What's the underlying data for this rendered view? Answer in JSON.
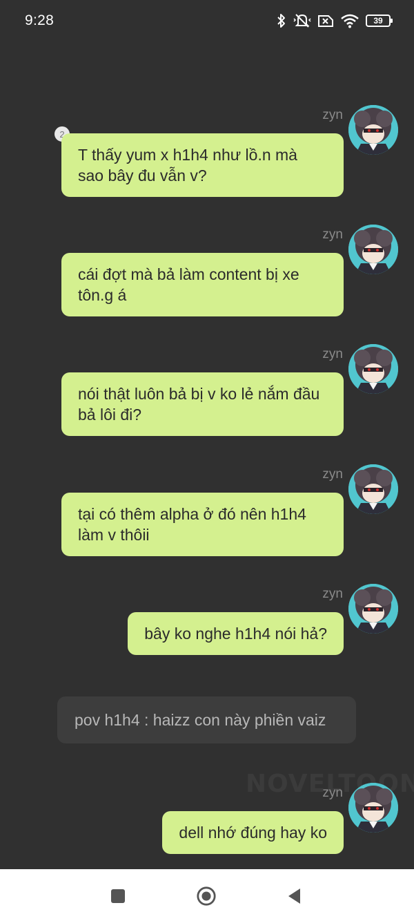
{
  "status_bar": {
    "time": "9:28",
    "battery_level": "39",
    "icons": [
      "bluetooth-icon",
      "mute-vibrate-icon",
      "no-sim-icon",
      "wifi-icon",
      "battery-icon"
    ]
  },
  "messages": [
    {
      "sender": "zyn",
      "text": "T thấy yum x h1h4 như lồ.n mà sao bây đu vẫn v?",
      "badge": "2"
    },
    {
      "sender": "zyn",
      "text": "cái đợt mà bả làm content bị xe tôn.g á"
    },
    {
      "sender": "zyn",
      "text": "nói thật luôn bả bị v ko lẻ nắm đầu bả lôi đi?"
    },
    {
      "sender": "zyn",
      "text": "tại có thêm alpha ở đó nên h1h4 làm v thôii"
    },
    {
      "sender": "zyn",
      "text": "bây ko nghe h1h4 nói hả?"
    },
    {
      "sender": "zyn",
      "text": "dell nhớ đúng hay ko"
    }
  ],
  "narration": "pov h1h4 : haizz con này phiền vaiz",
  "watermark": "NOVELTOON",
  "nav_bar": {
    "buttons": [
      "recent-apps-button",
      "home-button",
      "back-button"
    ]
  },
  "colors": {
    "background": "#303030",
    "bubble": "#d4f08f",
    "narration_bg": "#3d3d3d"
  }
}
